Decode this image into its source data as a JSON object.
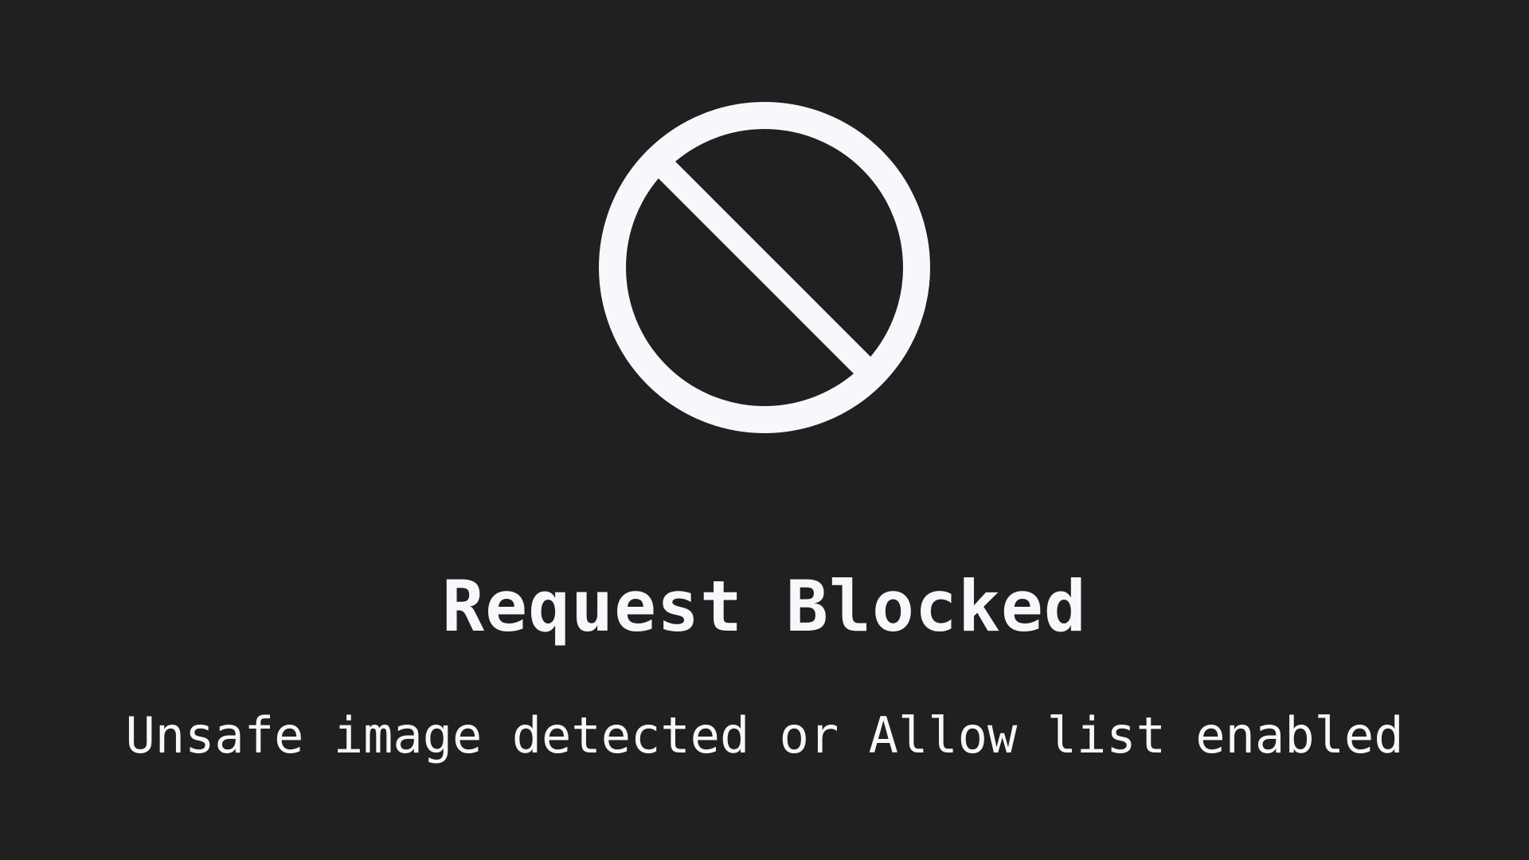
{
  "page": {
    "background_color": "#202020",
    "foreground_color": "#F7F8FC"
  },
  "status_icon": {
    "name": "blocked-icon"
  },
  "heading": {
    "text": "Request Blocked"
  },
  "message": {
    "text": "Unsafe image detected or Allow list enabled"
  }
}
